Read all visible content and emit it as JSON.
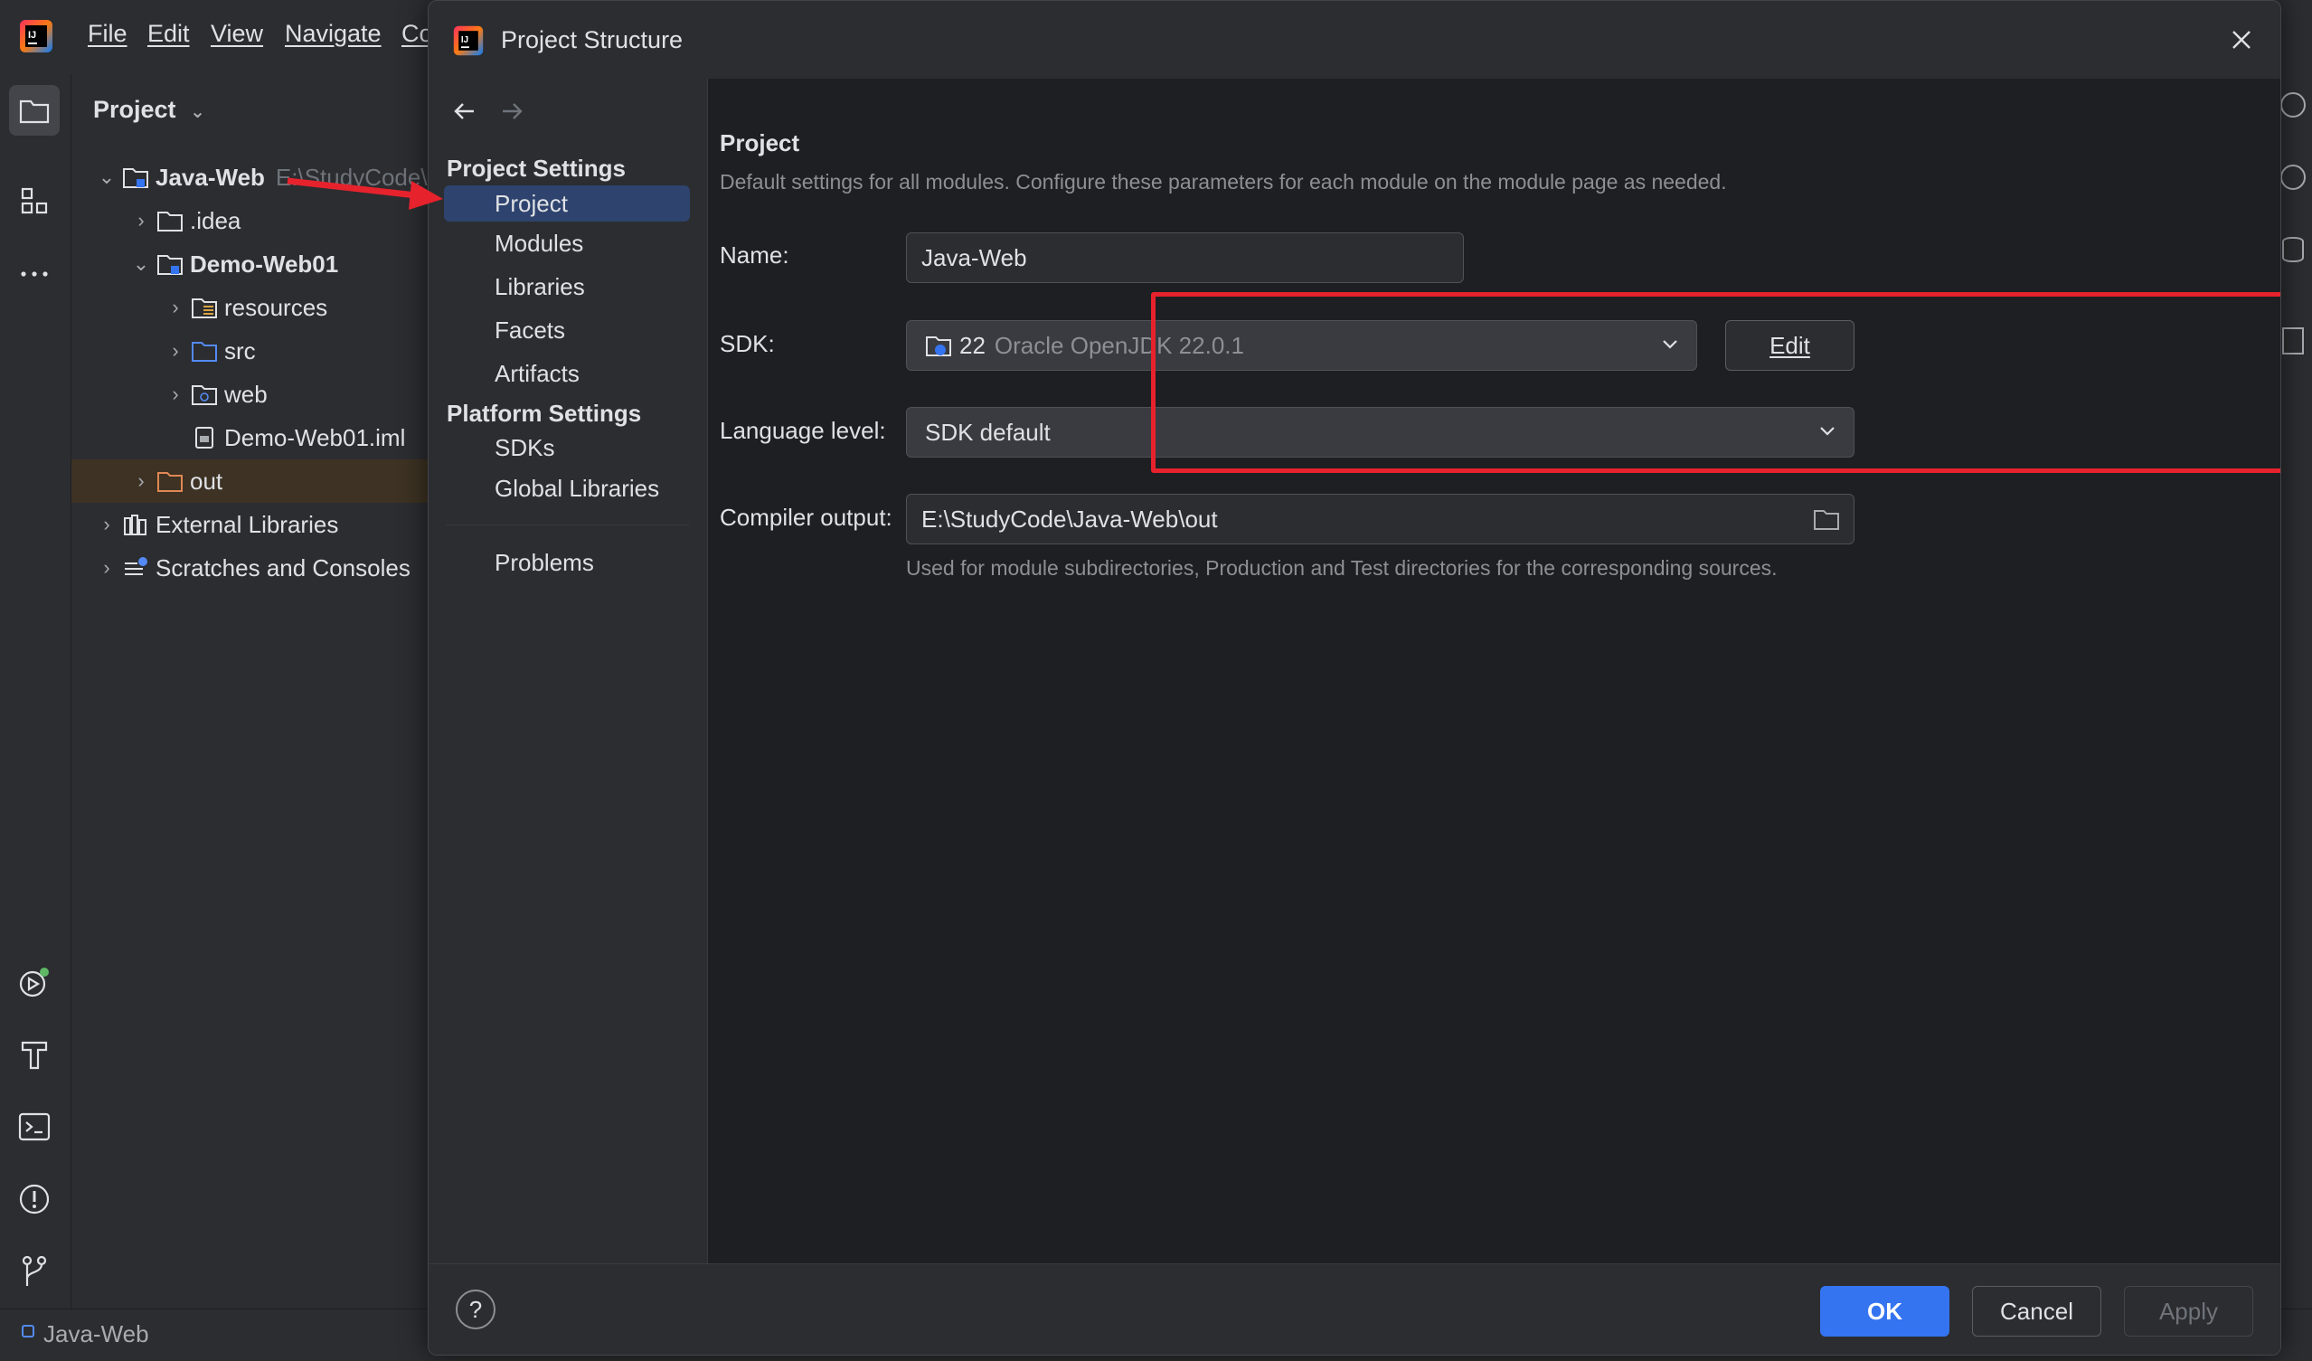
{
  "menu": [
    "File",
    "Edit",
    "View",
    "Navigate",
    "Co"
  ],
  "project_panel": {
    "title": "Project",
    "tree": [
      {
        "label": "Java-Web",
        "suffix": "E:\\StudyCode\\",
        "bold": true
      },
      {
        "label": ".idea"
      },
      {
        "label": "Demo-Web01",
        "bold": true
      },
      {
        "label": "resources"
      },
      {
        "label": "src"
      },
      {
        "label": "web"
      },
      {
        "label": "Demo-Web01.iml"
      },
      {
        "label": "out"
      },
      {
        "label": "External Libraries"
      },
      {
        "label": "Scratches and Consoles"
      }
    ]
  },
  "statusbar": {
    "project": "Java-Web"
  },
  "dialog": {
    "title": "Project Structure",
    "sidebar": {
      "project_settings_heading": "Project Settings",
      "project_settings": [
        "Project",
        "Modules",
        "Libraries",
        "Facets",
        "Artifacts"
      ],
      "platform_settings_heading": "Platform Settings",
      "platform_settings": [
        "SDKs",
        "Global Libraries"
      ],
      "problems": "Problems"
    },
    "content": {
      "heading": "Project",
      "description": "Default settings for all modules. Configure these parameters for each module on the module page as needed.",
      "name_label": "Name:",
      "name_value": "Java-Web",
      "sdk_label": "SDK:",
      "sdk_version": "22",
      "sdk_name": "Oracle OpenJDK 22.0.1",
      "edit_button": "Edit",
      "language_label": "Language level:",
      "language_value": "SDK default",
      "compiler_label": "Compiler output:",
      "compiler_value": "E:\\StudyCode\\Java-Web\\out",
      "compiler_hint": "Used for module subdirectories, Production and Test directories for the corresponding sources."
    },
    "footer": {
      "ok": "OK",
      "cancel": "Cancel",
      "apply": "Apply",
      "help": "?"
    }
  },
  "colors": {
    "accent": "#3574f0",
    "selection": "#2e436e",
    "annotation": "#e6222d"
  }
}
